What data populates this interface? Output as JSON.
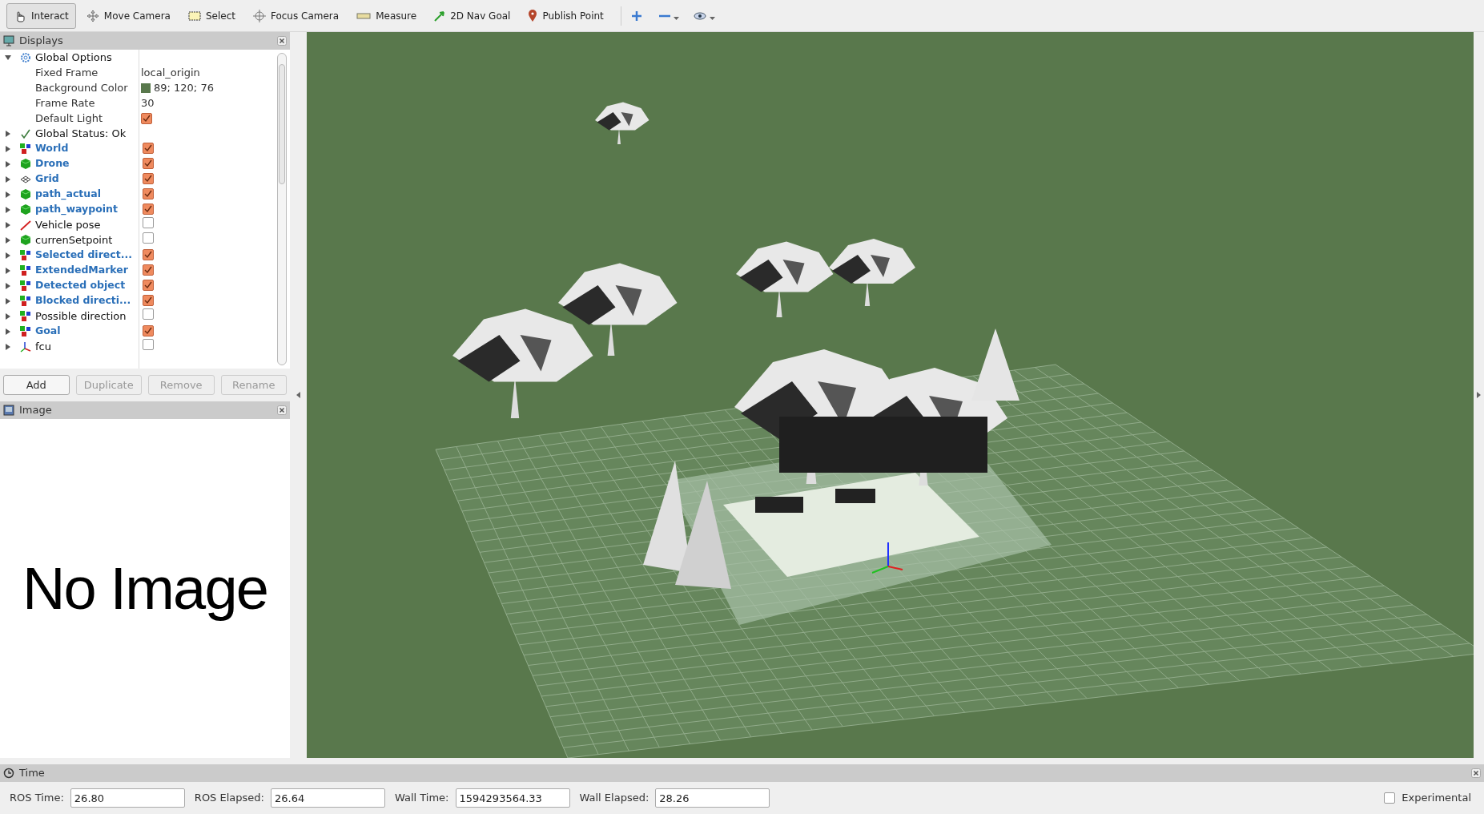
{
  "toolbar": {
    "tools": [
      {
        "kind": "interact",
        "label": "Interact",
        "selected": true
      },
      {
        "kind": "move",
        "label": "Move Camera",
        "selected": false
      },
      {
        "kind": "select",
        "label": "Select",
        "selected": false
      },
      {
        "kind": "focus",
        "label": "Focus Camera",
        "selected": false
      },
      {
        "kind": "measure",
        "label": "Measure",
        "selected": false
      },
      {
        "kind": "navgoal",
        "label": "2D Nav Goal",
        "selected": false
      },
      {
        "kind": "publish",
        "label": "Publish Point",
        "selected": false
      }
    ]
  },
  "displays": {
    "title": "Displays",
    "items": [
      {
        "kind": "options",
        "label": "Global Options",
        "expanded": true,
        "children": [
          {
            "label": "Fixed Frame",
            "value": "local_origin"
          },
          {
            "label": "Background Color",
            "value": "89; 120; 76",
            "color": "#59784c"
          },
          {
            "label": "Frame Rate",
            "value": "30"
          },
          {
            "label": "Default Light",
            "checked": true
          }
        ]
      },
      {
        "kind": "status",
        "label": "Global Status: Ok",
        "expanded": false
      },
      {
        "kind": "markers",
        "label": "World",
        "expanded": false,
        "checked": true
      },
      {
        "kind": "cube",
        "label": "Drone",
        "expanded": false,
        "checked": true
      },
      {
        "kind": "grid",
        "label": "Grid",
        "expanded": false,
        "checked": true
      },
      {
        "kind": "cube",
        "label": "path_actual",
        "expanded": false,
        "checked": true
      },
      {
        "kind": "cube",
        "label": "path_waypoint",
        "expanded": false,
        "checked": true
      },
      {
        "kind": "pose",
        "label": "Vehicle pose",
        "expanded": false,
        "checked": false
      },
      {
        "kind": "cube",
        "label": "currenSetpoint",
        "expanded": false,
        "checked": false
      },
      {
        "kind": "markers",
        "label": "Selected direct...",
        "expanded": false,
        "checked": true
      },
      {
        "kind": "markers",
        "label": "ExtendedMarker",
        "expanded": false,
        "checked": true
      },
      {
        "kind": "markers",
        "label": "Detected object",
        "expanded": false,
        "checked": true
      },
      {
        "kind": "markers",
        "label": "Blocked directi...",
        "expanded": false,
        "checked": true
      },
      {
        "kind": "markers",
        "label": "Possible direction",
        "expanded": false,
        "checked": false
      },
      {
        "kind": "markers",
        "label": "Goal",
        "expanded": false,
        "checked": true
      },
      {
        "kind": "axes",
        "label": "fcu",
        "expanded": false,
        "checked": false
      }
    ],
    "buttons": [
      {
        "label": "Add",
        "disabled": false
      },
      {
        "label": "Duplicate",
        "disabled": true
      },
      {
        "label": "Remove",
        "disabled": true
      },
      {
        "label": "Rename",
        "disabled": true
      }
    ]
  },
  "image_panel": {
    "title": "Image",
    "message": "No Image"
  },
  "time_panel": {
    "title": "Time",
    "fields": [
      {
        "label": "ROS Time:",
        "value": "26.80"
      },
      {
        "label": "ROS Elapsed:",
        "value": "26.64"
      },
      {
        "label": "Wall Time:",
        "value": "1594293564.33"
      },
      {
        "label": "Wall Elapsed:",
        "value": "28.26"
      }
    ],
    "experimental": {
      "label": "Experimental",
      "checked": false
    }
  }
}
